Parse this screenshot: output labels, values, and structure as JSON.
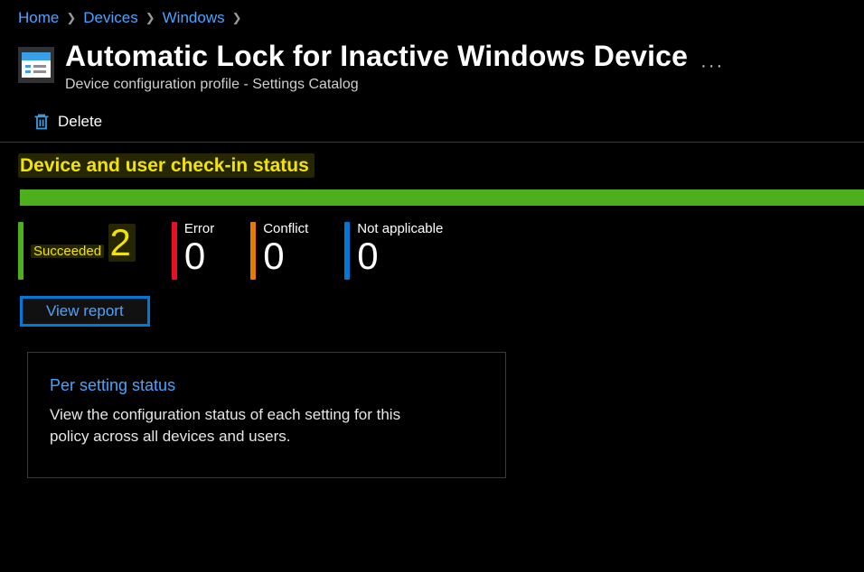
{
  "breadcrumb": {
    "home": "Home",
    "devices": "Devices",
    "windows": "Windows"
  },
  "header": {
    "title": "Automatic Lock for Inactive Windows Device",
    "subtitle": "Device configuration profile - Settings Catalog",
    "more": "···"
  },
  "commands": {
    "delete": "Delete"
  },
  "section": {
    "status_heading": "Device and user check-in status"
  },
  "stats": {
    "succeeded": {
      "label": "Succeeded",
      "value": "2"
    },
    "error": {
      "label": "Error",
      "value": "0"
    },
    "conflict": {
      "label": "Conflict",
      "value": "0"
    },
    "not_applicable": {
      "label": "Not applicable",
      "value": "0"
    }
  },
  "actions": {
    "view_report": "View report"
  },
  "card": {
    "title": "Per setting status",
    "desc": "View the configuration status of each setting for this policy across all devices and users."
  }
}
